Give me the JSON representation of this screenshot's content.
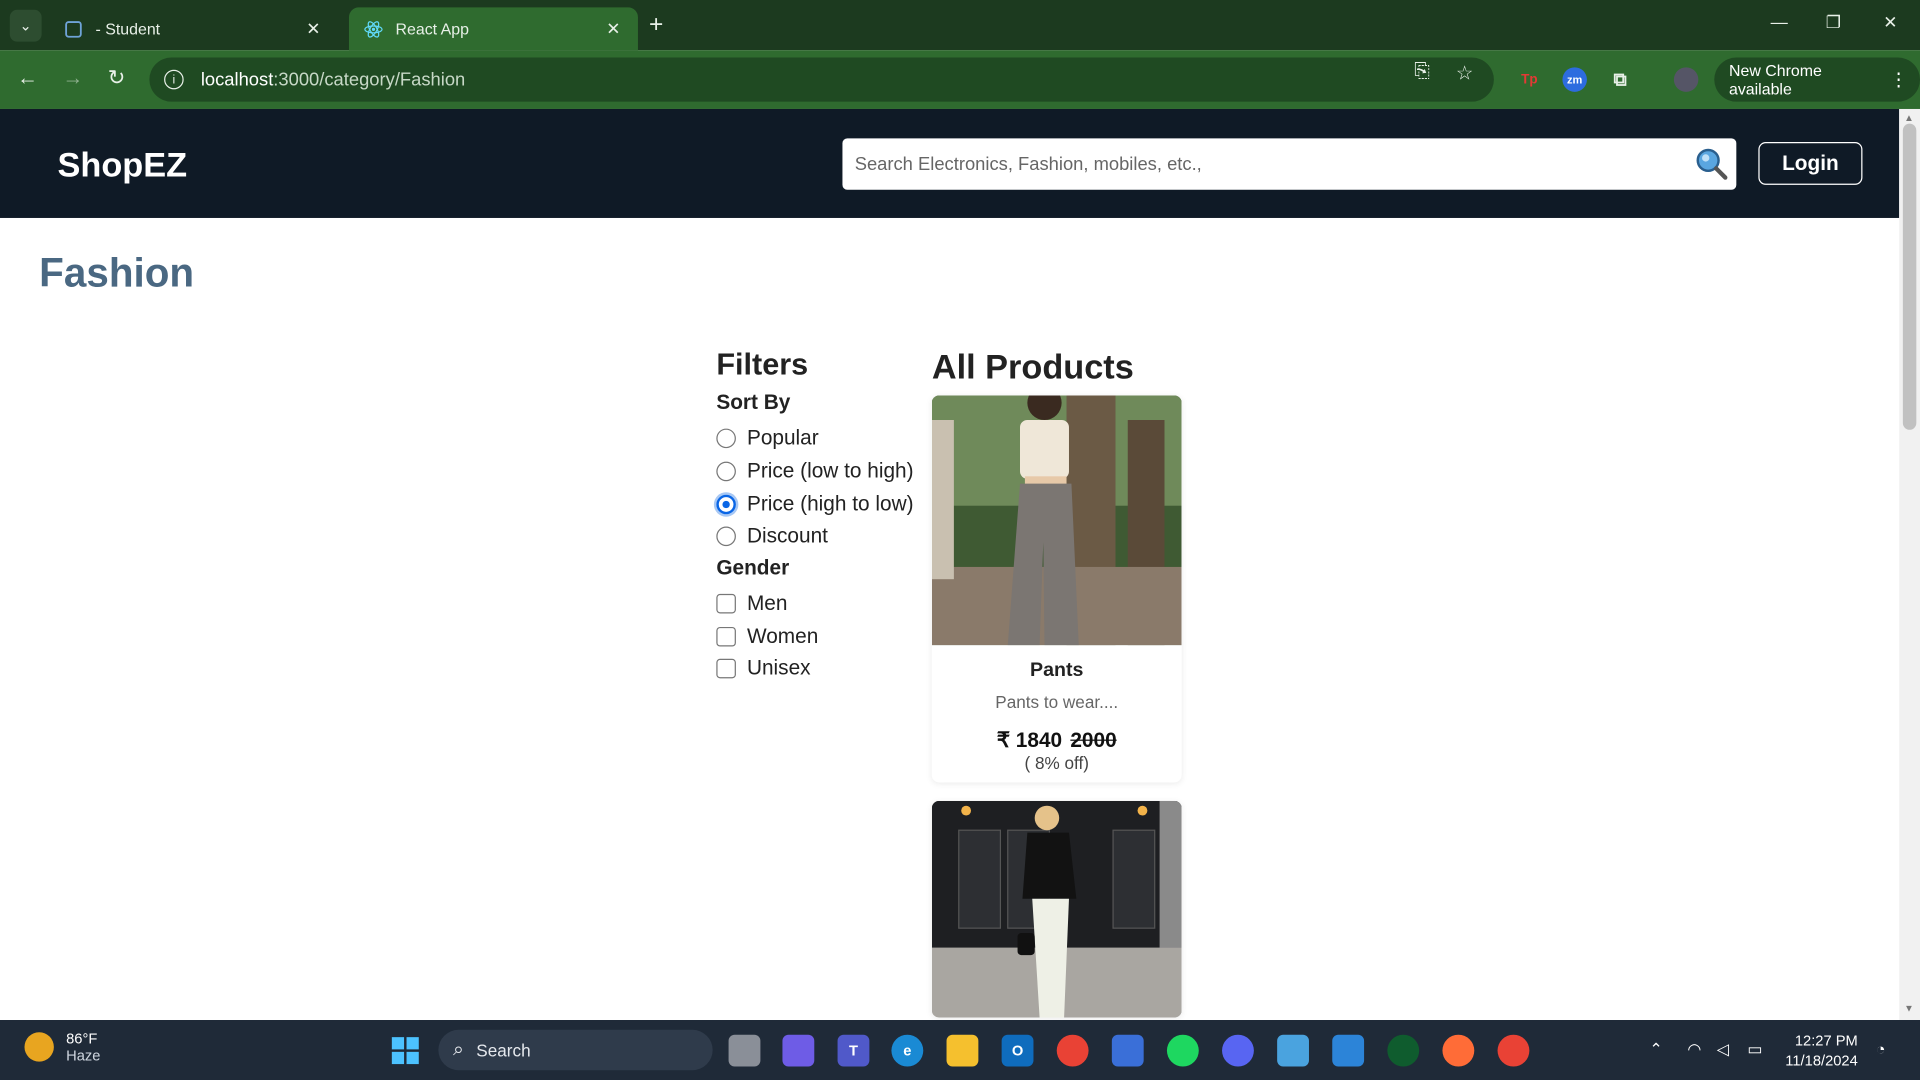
{
  "browser": {
    "tabs": [
      {
        "title": "- Student",
        "active": false
      },
      {
        "title": "React App",
        "active": true
      }
    ],
    "url_host": "localhost",
    "url_path": ":3000/category/Fashion",
    "new_chrome_label": "New Chrome available"
  },
  "header": {
    "logo": "ShopEZ",
    "search_placeholder": "Search Electronics, Fashion, mobiles, etc.,",
    "login_label": "Login"
  },
  "page": {
    "title": "Fashion"
  },
  "filters": {
    "heading": "Filters",
    "sort_heading": "Sort By",
    "sort_options": [
      {
        "label": "Popular",
        "selected": false
      },
      {
        "label": "Price (low to high)",
        "selected": false
      },
      {
        "label": "Price (high to low)",
        "selected": true
      },
      {
        "label": "Discount",
        "selected": false
      }
    ],
    "gender_heading": "Gender",
    "gender_options": [
      {
        "label": "Men",
        "checked": false
      },
      {
        "label": "Women",
        "checked": false
      },
      {
        "label": "Unisex",
        "checked": false
      }
    ]
  },
  "products": {
    "heading": "All Products",
    "items": [
      {
        "name": "Pants",
        "description": "Pants to wear....",
        "price": "₹ 1840",
        "original_price": "2000",
        "discount": "( 8% off)"
      }
    ]
  },
  "taskbar": {
    "temperature": "86°F",
    "condition": "Haze",
    "search_label": "Search",
    "time": "12:27 PM",
    "date": "11/18/2024"
  },
  "colors": {
    "header_bg": "#0f1a26",
    "title_color": "#4a6882",
    "chrome_frame": "#1c3a1f",
    "chrome_toolbar": "#2f6b2f",
    "radio_selected": "#0a66e6"
  }
}
